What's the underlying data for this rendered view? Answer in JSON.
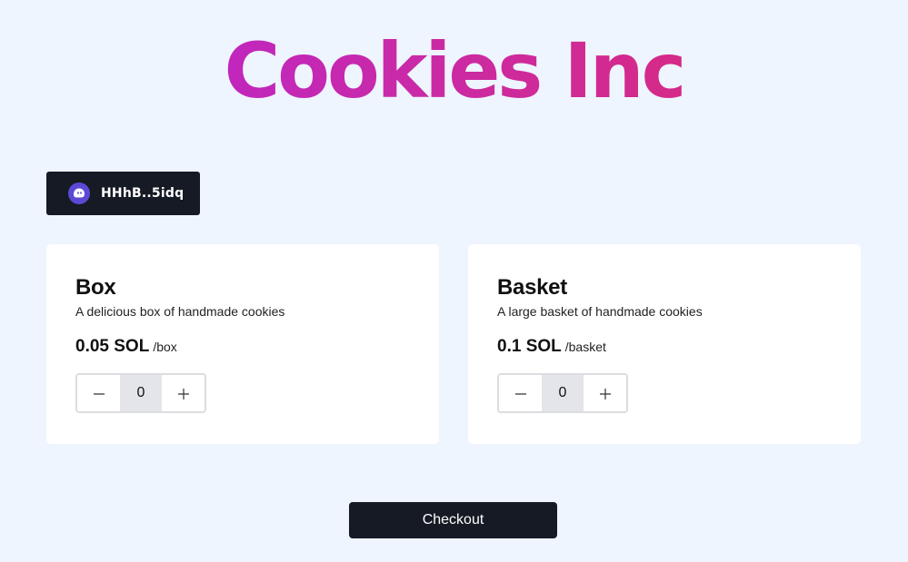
{
  "header": {
    "title": "Cookies Inc"
  },
  "wallet": {
    "address": "HHhB..5idq",
    "icon": "phantom-ghost-icon"
  },
  "products": [
    {
      "name": "Box",
      "description": "A delicious box of handmade cookies",
      "price": "0.05 SOL",
      "unit": "/box",
      "quantity": "0",
      "decrement_icon": "minus-icon",
      "increment_icon": "plus-icon"
    },
    {
      "name": "Basket",
      "description": "A large basket of handmade cookies",
      "price": "0.1 SOL",
      "unit": "/basket",
      "quantity": "0",
      "decrement_icon": "minus-icon",
      "increment_icon": "plus-icon"
    }
  ],
  "checkout": {
    "label": "Checkout"
  },
  "colors": {
    "background": "#eef5ff",
    "title_gradient_start": "#b623d6",
    "title_gradient_end": "#df2a6c",
    "dark_button": "#151a24",
    "wallet_icon": "#5b49d6"
  }
}
